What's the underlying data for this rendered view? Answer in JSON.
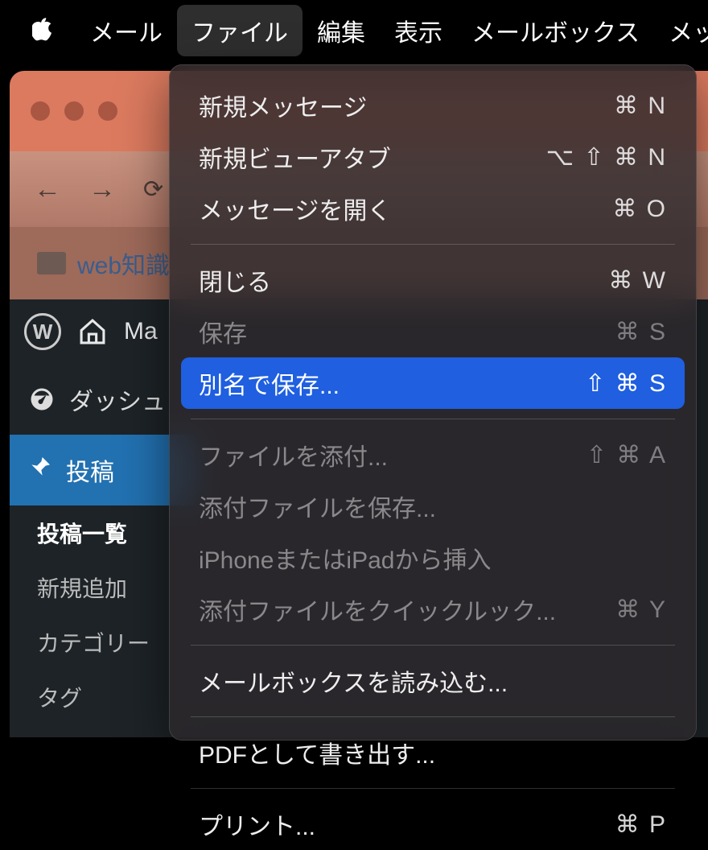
{
  "menubar": {
    "app": "メール",
    "items": [
      "ファイル",
      "編集",
      "表示",
      "メールボックス",
      "メッ"
    ]
  },
  "browser": {
    "bookmark_label": "web知識"
  },
  "wp": {
    "site_label": "Ma",
    "dashboard": "ダッシュ",
    "posts": "投稿",
    "posts_list": "投稿一覧",
    "posts_new": "新規追加",
    "categories": "カテゴリー",
    "tags": "タグ"
  },
  "menu": {
    "new_message": {
      "label": "新規メッセージ",
      "shortcut": "⌘ N"
    },
    "new_viewer_tab": {
      "label": "新規ビューアタブ",
      "shortcut": "⌥ ⇧ ⌘ N"
    },
    "open_message": {
      "label": "メッセージを開く",
      "shortcut": "⌘ O"
    },
    "close": {
      "label": "閉じる",
      "shortcut": "⌘ W"
    },
    "save": {
      "label": "保存",
      "shortcut": "⌘ S"
    },
    "save_as": {
      "label": "別名で保存...",
      "shortcut": "⇧ ⌘ S"
    },
    "attach_file": {
      "label": "ファイルを添付...",
      "shortcut": "⇧ ⌘ A"
    },
    "save_attachments": {
      "label": "添付ファイルを保存...",
      "shortcut": ""
    },
    "insert_from_device": {
      "label": "iPhoneまたはiPadから挿入",
      "shortcut": ""
    },
    "quick_look_attachments": {
      "label": "添付ファイルをクイックルック...",
      "shortcut": "⌘ Y"
    },
    "import_mailbox": {
      "label": "メールボックスを読み込む...",
      "shortcut": ""
    },
    "export_pdf": {
      "label": "PDFとして書き出す...",
      "shortcut": ""
    },
    "print": {
      "label": "プリント...",
      "shortcut": "⌘ P"
    }
  }
}
